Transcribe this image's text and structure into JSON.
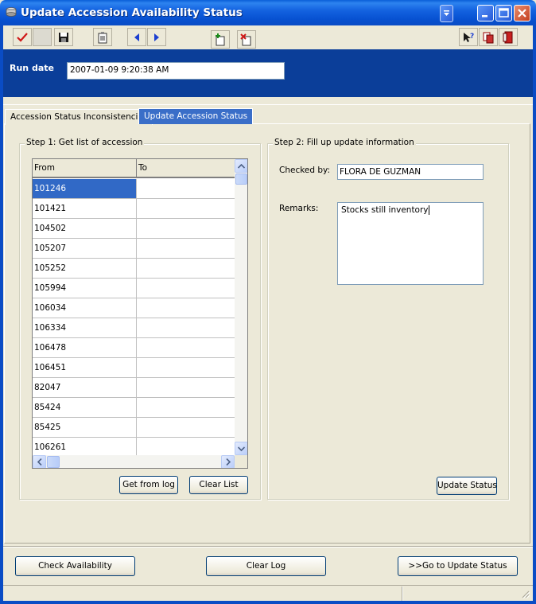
{
  "window": {
    "title": "Update Accession Availability Status"
  },
  "toolbar": {
    "left_tools": [
      "check-icon",
      "blank-icon",
      "save-icon",
      "clipboard-icon",
      "arrow-left-icon",
      "arrow-right-icon",
      "add-record-icon",
      "delete-record-icon"
    ],
    "right_tools": [
      "help-icon",
      "copy-icon",
      "exit-icon"
    ]
  },
  "run_date": {
    "label": "Run date",
    "value": "2007-01-09 9:20:38 AM"
  },
  "tabs": [
    {
      "label": "Accession Status Inconsistencies",
      "active": false
    },
    {
      "label": "Update Accession Status",
      "active": true
    }
  ],
  "step1": {
    "title": "Step 1: Get list of accession",
    "columns": [
      "From",
      "To"
    ],
    "rows": [
      {
        "from": "101246",
        "to": "",
        "selected": true
      },
      {
        "from": "101421",
        "to": ""
      },
      {
        "from": "104502",
        "to": ""
      },
      {
        "from": "105207",
        "to": ""
      },
      {
        "from": "105252",
        "to": ""
      },
      {
        "from": "105994",
        "to": ""
      },
      {
        "from": "106034",
        "to": ""
      },
      {
        "from": "106334",
        "to": ""
      },
      {
        "from": "106478",
        "to": ""
      },
      {
        "from": "106451",
        "to": ""
      },
      {
        "from": "82047",
        "to": ""
      },
      {
        "from": "85424",
        "to": ""
      },
      {
        "from": "85425",
        "to": ""
      },
      {
        "from": "106261",
        "to": ""
      }
    ],
    "get_from_log_button": "Get from log",
    "clear_list_button": "Clear List"
  },
  "step2": {
    "title": "Step 2: Fill up update information",
    "checked_by_label": "Checked by:",
    "checked_by_value": "FLORA DE GUZMAN",
    "remarks_label": "Remarks:",
    "remarks_value": "Stocks still inventory",
    "update_status_button": "Update Status"
  },
  "footer": {
    "check_availability_button": "Check Availability",
    "clear_log_button": "Clear Log",
    "go_to_update_button": ">>Go to Update Status"
  },
  "colors": {
    "title_bar": "#0a4cc5",
    "run_date_panel": "#0b3e99",
    "active_tab": "#3a6ec8",
    "selection": "#3169c6",
    "face": "#ece9d8"
  }
}
